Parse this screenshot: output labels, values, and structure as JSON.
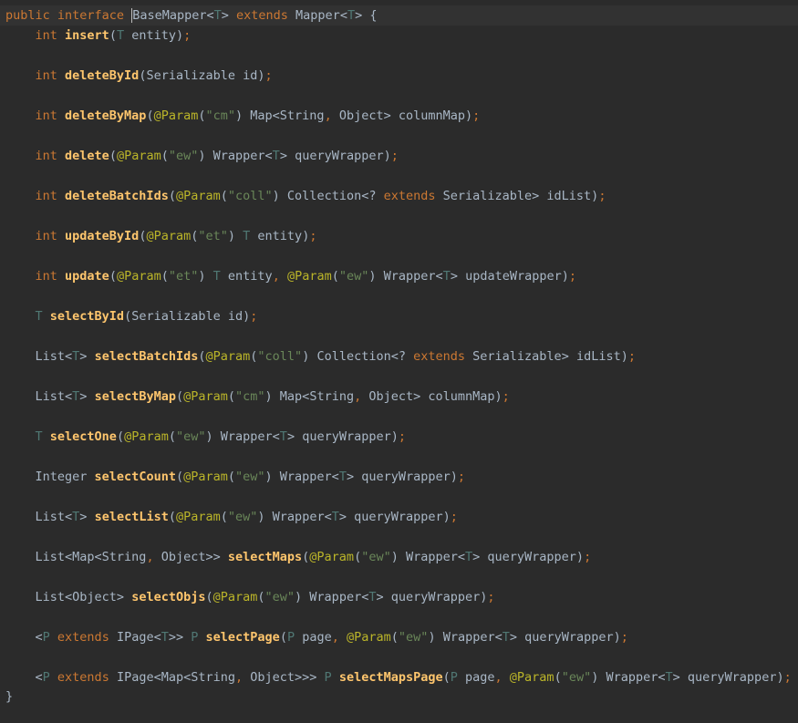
{
  "theme": {
    "background": "#2b2b2b",
    "current_line": "#323232",
    "keyword": "#cc7832",
    "type_param": "#507874",
    "method": "#ffc66d",
    "annotation": "#bbb529",
    "string": "#6a8759",
    "default": "#a9b7c6"
  },
  "code": {
    "lines": [
      {
        "indent": "",
        "tokens": [
          {
            "t": "public ",
            "c": "kw"
          },
          {
            "t": "interface ",
            "c": "kw"
          },
          {
            "t": "BaseMapper",
            "c": "type",
            "caret": true
          },
          {
            "t": "<",
            "c": "punc"
          },
          {
            "t": "T",
            "c": "tp"
          },
          {
            "t": "> ",
            "c": "punc"
          },
          {
            "t": "extends ",
            "c": "kw"
          },
          {
            "t": "Mapper",
            "c": "type"
          },
          {
            "t": "<",
            "c": "punc"
          },
          {
            "t": "T",
            "c": "tp"
          },
          {
            "t": "> {",
            "c": "punc"
          }
        ]
      },
      {
        "indent": "    ",
        "tokens": [
          {
            "t": "int ",
            "c": "kw"
          },
          {
            "t": "insert",
            "c": "fn"
          },
          {
            "t": "(",
            "c": "punc"
          },
          {
            "t": "T ",
            "c": "tp"
          },
          {
            "t": "entity)",
            "c": "plain"
          },
          {
            "t": ";",
            "c": "sem"
          }
        ]
      },
      {
        "indent": "",
        "tokens": []
      },
      {
        "indent": "    ",
        "tokens": [
          {
            "t": "int ",
            "c": "kw"
          },
          {
            "t": "deleteById",
            "c": "fn"
          },
          {
            "t": "(Serializable id)",
            "c": "plain"
          },
          {
            "t": ";",
            "c": "sem"
          }
        ]
      },
      {
        "indent": "",
        "tokens": []
      },
      {
        "indent": "    ",
        "tokens": [
          {
            "t": "int ",
            "c": "kw"
          },
          {
            "t": "deleteByMap",
            "c": "fn"
          },
          {
            "t": "(",
            "c": "punc"
          },
          {
            "t": "@Param",
            "c": "ann"
          },
          {
            "t": "(",
            "c": "punc"
          },
          {
            "t": "\"cm\"",
            "c": "str"
          },
          {
            "t": ") Map<String",
            "c": "plain"
          },
          {
            "t": ", ",
            "c": "sem"
          },
          {
            "t": "Object> columnMap)",
            "c": "plain"
          },
          {
            "t": ";",
            "c": "sem"
          }
        ]
      },
      {
        "indent": "",
        "tokens": []
      },
      {
        "indent": "    ",
        "tokens": [
          {
            "t": "int ",
            "c": "kw"
          },
          {
            "t": "delete",
            "c": "fn"
          },
          {
            "t": "(",
            "c": "punc"
          },
          {
            "t": "@Param",
            "c": "ann"
          },
          {
            "t": "(",
            "c": "punc"
          },
          {
            "t": "\"ew\"",
            "c": "str"
          },
          {
            "t": ") Wrapper<",
            "c": "plain"
          },
          {
            "t": "T",
            "c": "tp"
          },
          {
            "t": "> queryWrapper)",
            "c": "plain"
          },
          {
            "t": ";",
            "c": "sem"
          }
        ]
      },
      {
        "indent": "",
        "tokens": []
      },
      {
        "indent": "    ",
        "tokens": [
          {
            "t": "int ",
            "c": "kw"
          },
          {
            "t": "deleteBatchIds",
            "c": "fn"
          },
          {
            "t": "(",
            "c": "punc"
          },
          {
            "t": "@Param",
            "c": "ann"
          },
          {
            "t": "(",
            "c": "punc"
          },
          {
            "t": "\"coll\"",
            "c": "str"
          },
          {
            "t": ") Collection<? ",
            "c": "plain"
          },
          {
            "t": "extends ",
            "c": "kw"
          },
          {
            "t": "Serializable> idList)",
            "c": "plain"
          },
          {
            "t": ";",
            "c": "sem"
          }
        ]
      },
      {
        "indent": "",
        "tokens": []
      },
      {
        "indent": "    ",
        "tokens": [
          {
            "t": "int ",
            "c": "kw"
          },
          {
            "t": "updateById",
            "c": "fn"
          },
          {
            "t": "(",
            "c": "punc"
          },
          {
            "t": "@Param",
            "c": "ann"
          },
          {
            "t": "(",
            "c": "punc"
          },
          {
            "t": "\"et\"",
            "c": "str"
          },
          {
            "t": ") ",
            "c": "plain"
          },
          {
            "t": "T ",
            "c": "tp"
          },
          {
            "t": "entity)",
            "c": "plain"
          },
          {
            "t": ";",
            "c": "sem"
          }
        ]
      },
      {
        "indent": "",
        "tokens": []
      },
      {
        "indent": "    ",
        "tokens": [
          {
            "t": "int ",
            "c": "kw"
          },
          {
            "t": "update",
            "c": "fn"
          },
          {
            "t": "(",
            "c": "punc"
          },
          {
            "t": "@Param",
            "c": "ann"
          },
          {
            "t": "(",
            "c": "punc"
          },
          {
            "t": "\"et\"",
            "c": "str"
          },
          {
            "t": ") ",
            "c": "plain"
          },
          {
            "t": "T ",
            "c": "tp"
          },
          {
            "t": "entity",
            "c": "plain"
          },
          {
            "t": ", ",
            "c": "sem"
          },
          {
            "t": "@Param",
            "c": "ann"
          },
          {
            "t": "(",
            "c": "punc"
          },
          {
            "t": "\"ew\"",
            "c": "str"
          },
          {
            "t": ") Wrapper<",
            "c": "plain"
          },
          {
            "t": "T",
            "c": "tp"
          },
          {
            "t": "> updateWrapper)",
            "c": "plain"
          },
          {
            "t": ";",
            "c": "sem"
          }
        ]
      },
      {
        "indent": "",
        "tokens": []
      },
      {
        "indent": "    ",
        "tokens": [
          {
            "t": "T ",
            "c": "tp"
          },
          {
            "t": "selectById",
            "c": "fn"
          },
          {
            "t": "(Serializable id)",
            "c": "plain"
          },
          {
            "t": ";",
            "c": "sem"
          }
        ]
      },
      {
        "indent": "",
        "tokens": []
      },
      {
        "indent": "    ",
        "tokens": [
          {
            "t": "List<",
            "c": "plain"
          },
          {
            "t": "T",
            "c": "tp"
          },
          {
            "t": "> ",
            "c": "plain"
          },
          {
            "t": "selectBatchIds",
            "c": "fn"
          },
          {
            "t": "(",
            "c": "punc"
          },
          {
            "t": "@Param",
            "c": "ann"
          },
          {
            "t": "(",
            "c": "punc"
          },
          {
            "t": "\"coll\"",
            "c": "str"
          },
          {
            "t": ") Collection<? ",
            "c": "plain"
          },
          {
            "t": "extends ",
            "c": "kw"
          },
          {
            "t": "Serializable> idList)",
            "c": "plain"
          },
          {
            "t": ";",
            "c": "sem"
          }
        ]
      },
      {
        "indent": "",
        "tokens": []
      },
      {
        "indent": "    ",
        "tokens": [
          {
            "t": "List<",
            "c": "plain"
          },
          {
            "t": "T",
            "c": "tp"
          },
          {
            "t": "> ",
            "c": "plain"
          },
          {
            "t": "selectByMap",
            "c": "fn"
          },
          {
            "t": "(",
            "c": "punc"
          },
          {
            "t": "@Param",
            "c": "ann"
          },
          {
            "t": "(",
            "c": "punc"
          },
          {
            "t": "\"cm\"",
            "c": "str"
          },
          {
            "t": ") Map<String",
            "c": "plain"
          },
          {
            "t": ", ",
            "c": "sem"
          },
          {
            "t": "Object> columnMap)",
            "c": "plain"
          },
          {
            "t": ";",
            "c": "sem"
          }
        ]
      },
      {
        "indent": "",
        "tokens": []
      },
      {
        "indent": "    ",
        "tokens": [
          {
            "t": "T ",
            "c": "tp"
          },
          {
            "t": "selectOne",
            "c": "fn"
          },
          {
            "t": "(",
            "c": "punc"
          },
          {
            "t": "@Param",
            "c": "ann"
          },
          {
            "t": "(",
            "c": "punc"
          },
          {
            "t": "\"ew\"",
            "c": "str"
          },
          {
            "t": ") Wrapper<",
            "c": "plain"
          },
          {
            "t": "T",
            "c": "tp"
          },
          {
            "t": "> queryWrapper)",
            "c": "plain"
          },
          {
            "t": ";",
            "c": "sem"
          }
        ]
      },
      {
        "indent": "",
        "tokens": []
      },
      {
        "indent": "    ",
        "tokens": [
          {
            "t": "Integer ",
            "c": "plain"
          },
          {
            "t": "selectCount",
            "c": "fn"
          },
          {
            "t": "(",
            "c": "punc"
          },
          {
            "t": "@Param",
            "c": "ann"
          },
          {
            "t": "(",
            "c": "punc"
          },
          {
            "t": "\"ew\"",
            "c": "str"
          },
          {
            "t": ") Wrapper<",
            "c": "plain"
          },
          {
            "t": "T",
            "c": "tp"
          },
          {
            "t": "> queryWrapper)",
            "c": "plain"
          },
          {
            "t": ";",
            "c": "sem"
          }
        ]
      },
      {
        "indent": "",
        "tokens": []
      },
      {
        "indent": "    ",
        "tokens": [
          {
            "t": "List<",
            "c": "plain"
          },
          {
            "t": "T",
            "c": "tp"
          },
          {
            "t": "> ",
            "c": "plain"
          },
          {
            "t": "selectList",
            "c": "fn"
          },
          {
            "t": "(",
            "c": "punc"
          },
          {
            "t": "@Param",
            "c": "ann"
          },
          {
            "t": "(",
            "c": "punc"
          },
          {
            "t": "\"ew\"",
            "c": "str"
          },
          {
            "t": ") Wrapper<",
            "c": "plain"
          },
          {
            "t": "T",
            "c": "tp"
          },
          {
            "t": "> queryWrapper)",
            "c": "plain"
          },
          {
            "t": ";",
            "c": "sem"
          }
        ]
      },
      {
        "indent": "",
        "tokens": []
      },
      {
        "indent": "    ",
        "tokens": [
          {
            "t": "List<Map<String",
            "c": "plain"
          },
          {
            "t": ", ",
            "c": "sem"
          },
          {
            "t": "Object>> ",
            "c": "plain"
          },
          {
            "t": "selectMaps",
            "c": "fn"
          },
          {
            "t": "(",
            "c": "punc"
          },
          {
            "t": "@Param",
            "c": "ann"
          },
          {
            "t": "(",
            "c": "punc"
          },
          {
            "t": "\"ew\"",
            "c": "str"
          },
          {
            "t": ") Wrapper<",
            "c": "plain"
          },
          {
            "t": "T",
            "c": "tp"
          },
          {
            "t": "> queryWrapper)",
            "c": "plain"
          },
          {
            "t": ";",
            "c": "sem"
          }
        ]
      },
      {
        "indent": "",
        "tokens": []
      },
      {
        "indent": "    ",
        "tokens": [
          {
            "t": "List<Object> ",
            "c": "plain"
          },
          {
            "t": "selectObjs",
            "c": "fn"
          },
          {
            "t": "(",
            "c": "punc"
          },
          {
            "t": "@Param",
            "c": "ann"
          },
          {
            "t": "(",
            "c": "punc"
          },
          {
            "t": "\"ew\"",
            "c": "str"
          },
          {
            "t": ") Wrapper<",
            "c": "plain"
          },
          {
            "t": "T",
            "c": "tp"
          },
          {
            "t": "> queryWrapper)",
            "c": "plain"
          },
          {
            "t": ";",
            "c": "sem"
          }
        ]
      },
      {
        "indent": "",
        "tokens": []
      },
      {
        "indent": "    ",
        "tokens": [
          {
            "t": "<",
            "c": "plain"
          },
          {
            "t": "P ",
            "c": "tp"
          },
          {
            "t": "extends ",
            "c": "kw"
          },
          {
            "t": "IPage<",
            "c": "plain"
          },
          {
            "t": "T",
            "c": "tp"
          },
          {
            "t": ">> ",
            "c": "plain"
          },
          {
            "t": "P ",
            "c": "tp"
          },
          {
            "t": "selectPage",
            "c": "fn"
          },
          {
            "t": "(",
            "c": "punc"
          },
          {
            "t": "P ",
            "c": "tp"
          },
          {
            "t": "page",
            "c": "plain"
          },
          {
            "t": ", ",
            "c": "sem"
          },
          {
            "t": "@Param",
            "c": "ann"
          },
          {
            "t": "(",
            "c": "punc"
          },
          {
            "t": "\"ew\"",
            "c": "str"
          },
          {
            "t": ") Wrapper<",
            "c": "plain"
          },
          {
            "t": "T",
            "c": "tp"
          },
          {
            "t": "> queryWrapper)",
            "c": "plain"
          },
          {
            "t": ";",
            "c": "sem"
          }
        ]
      },
      {
        "indent": "",
        "tokens": []
      },
      {
        "indent": "    ",
        "tokens": [
          {
            "t": "<",
            "c": "plain"
          },
          {
            "t": "P ",
            "c": "tp"
          },
          {
            "t": "extends ",
            "c": "kw"
          },
          {
            "t": "IPage<Map<String",
            "c": "plain"
          },
          {
            "t": ", ",
            "c": "sem"
          },
          {
            "t": "Object>>> ",
            "c": "plain"
          },
          {
            "t": "P ",
            "c": "tp"
          },
          {
            "t": "selectMapsPage",
            "c": "fn"
          },
          {
            "t": "(",
            "c": "punc"
          },
          {
            "t": "P ",
            "c": "tp"
          },
          {
            "t": "page",
            "c": "plain"
          },
          {
            "t": ", ",
            "c": "sem"
          },
          {
            "t": "@Param",
            "c": "ann"
          },
          {
            "t": "(",
            "c": "punc"
          },
          {
            "t": "\"ew\"",
            "c": "str"
          },
          {
            "t": ") Wrapper<",
            "c": "plain"
          },
          {
            "t": "T",
            "c": "tp"
          },
          {
            "t": "> queryWrapper)",
            "c": "plain"
          },
          {
            "t": ";",
            "c": "sem"
          }
        ]
      },
      {
        "indent": "",
        "tokens": [
          {
            "t": "}",
            "c": "plain",
            "outdent": true
          }
        ]
      }
    ]
  }
}
